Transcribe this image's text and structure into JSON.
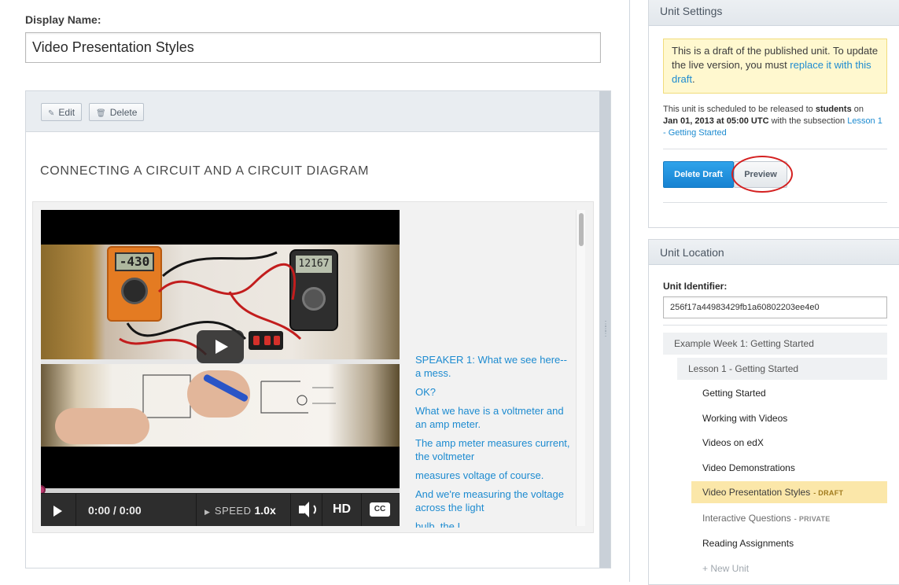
{
  "display_name": {
    "label": "Display Name:",
    "value": "Video Presentation Styles"
  },
  "component": {
    "edit_label": "Edit",
    "delete_label": "Delete",
    "title": "CONNECTING A CIRCUIT AND A CIRCUIT DIAGRAM",
    "video": {
      "meter_left_reading": "-430",
      "meter_right_reading": "12167",
      "time": "0:00 / 0:00",
      "speed_label": "SPEED",
      "speed_value": "1.0x",
      "hd_label": "HD",
      "cc_label": "CC",
      "progress": 0
    },
    "transcript": [
      "SPEAKER 1: What we see here-- a mess.",
      "OK?",
      "What we have is a voltmeter and an amp meter.",
      "The amp meter measures current, the voltmeter",
      "measures voltage of course.",
      "And we're measuring the voltage across the light",
      "bulb, the I"
    ]
  },
  "unit_settings": {
    "title": "Unit Settings",
    "notice_text": "This is a draft of the published unit. To update the live version, you must ",
    "notice_link": "replace it with this draft",
    "notice_end": ".",
    "schedule_prefix": "This unit is scheduled to be released to ",
    "schedule_audience": "students",
    "schedule_on": " on ",
    "schedule_date": "Jan 01, 2013 at 05:00 UTC",
    "schedule_with": " with the subsection ",
    "schedule_link": "Lesson 1 - Getting Started",
    "delete_draft_label": "Delete Draft",
    "preview_label": "Preview"
  },
  "unit_location": {
    "title": "Unit Location",
    "identifier_label": "Unit Identifier:",
    "identifier_value": "256f17a44983429fb1a60802203ee4e0",
    "week": "Example Week 1: Getting Started",
    "lesson": "Lesson 1 - Getting Started",
    "units": [
      {
        "label": "Getting Started",
        "tag": ""
      },
      {
        "label": "Working with Videos",
        "tag": ""
      },
      {
        "label": "Videos on edX",
        "tag": ""
      },
      {
        "label": "Video Demonstrations",
        "tag": ""
      },
      {
        "label": "Video Presentation Styles",
        "tag": "- DRAFT"
      },
      {
        "label": "Interactive Questions",
        "tag": "- PRIVATE"
      },
      {
        "label": "Reading Assignments",
        "tag": ""
      }
    ],
    "new_unit_label": "+ New Unit"
  },
  "colors": {
    "link": "#1d8bd0",
    "primary_button": "#1783d2",
    "active_unit": "#fbe7a9",
    "notice_bg": "#fff8cf",
    "highlight_circle": "#d42020"
  }
}
